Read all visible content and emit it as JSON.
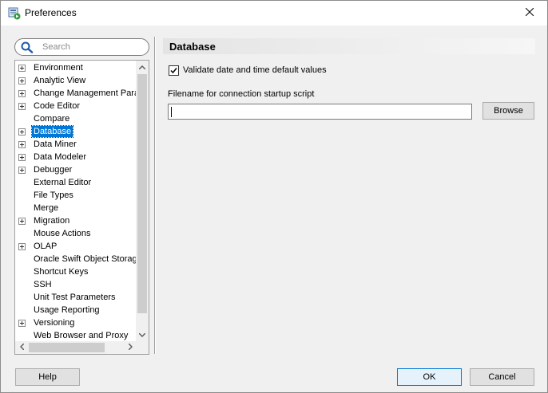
{
  "window": {
    "title": "Preferences",
    "icon": "preferences-app-icon",
    "close_icon": "close-icon"
  },
  "search": {
    "placeholder": "Search",
    "value": ""
  },
  "tree": {
    "selected": "Database",
    "items": [
      {
        "label": "Environment",
        "expandable": true
      },
      {
        "label": "Analytic View",
        "expandable": true
      },
      {
        "label": "Change Management Param",
        "expandable": true
      },
      {
        "label": "Code Editor",
        "expandable": true
      },
      {
        "label": "Compare",
        "expandable": false
      },
      {
        "label": "Database",
        "expandable": true
      },
      {
        "label": "Data Miner",
        "expandable": true
      },
      {
        "label": "Data Modeler",
        "expandable": true
      },
      {
        "label": "Debugger",
        "expandable": true
      },
      {
        "label": "External Editor",
        "expandable": false
      },
      {
        "label": "File Types",
        "expandable": false
      },
      {
        "label": "Merge",
        "expandable": false
      },
      {
        "label": "Migration",
        "expandable": true
      },
      {
        "label": "Mouse Actions",
        "expandable": false
      },
      {
        "label": "OLAP",
        "expandable": true
      },
      {
        "label": "Oracle Swift Object Storage",
        "expandable": false
      },
      {
        "label": "Shortcut Keys",
        "expandable": false
      },
      {
        "label": "SSH",
        "expandable": false
      },
      {
        "label": "Unit Test Parameters",
        "expandable": false
      },
      {
        "label": "Usage Reporting",
        "expandable": false
      },
      {
        "label": "Versioning",
        "expandable": true
      },
      {
        "label": "Web Browser and Proxy",
        "expandable": false
      }
    ]
  },
  "panel": {
    "title": "Database",
    "validate_checkbox": {
      "label": "Validate date and time default values",
      "checked": true
    },
    "startup_script": {
      "label": "Filename for connection startup script",
      "value": "",
      "browse_label": "Browse"
    }
  },
  "footer": {
    "help_label": "Help",
    "ok_label": "OK",
    "cancel_label": "Cancel"
  },
  "colors": {
    "selection": "#0078d7",
    "background": "#f0f0f0",
    "default_button_border": "#0078d7"
  }
}
